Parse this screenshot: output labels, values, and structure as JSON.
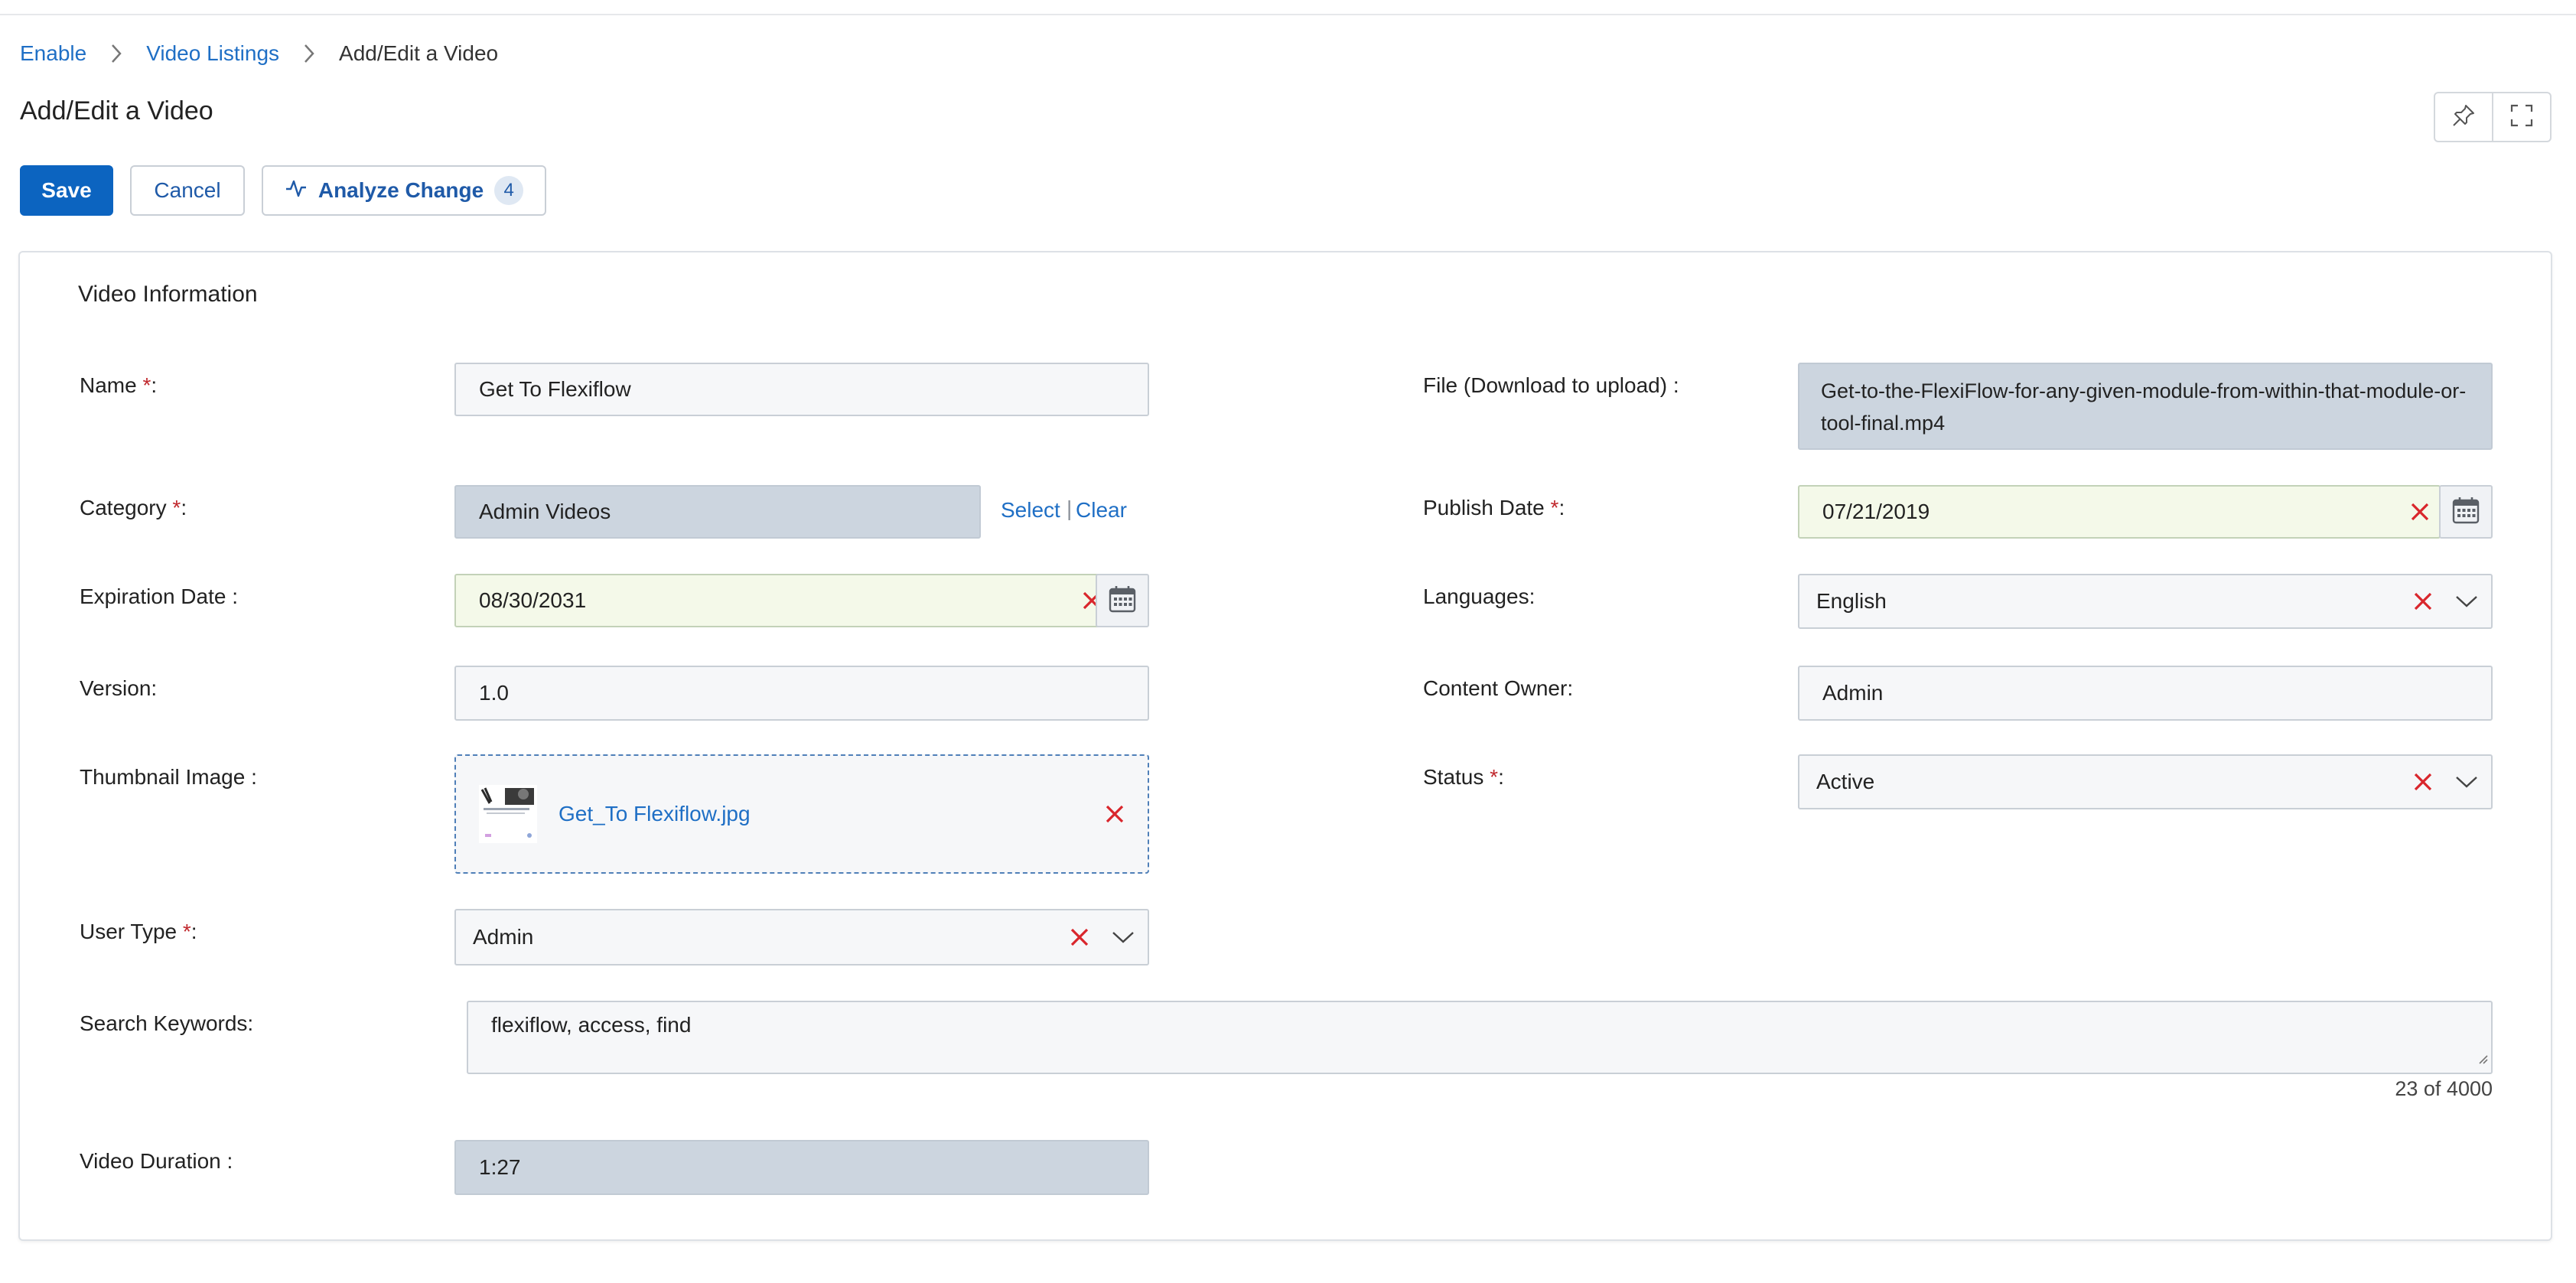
{
  "breadcrumb": {
    "items": [
      "Enable",
      "Video Listings"
    ],
    "current": "Add/Edit a Video"
  },
  "page": {
    "title": "Add/Edit a Video"
  },
  "toolbar": {
    "save_label": "Save",
    "cancel_label": "Cancel",
    "analyze_label": "Analyze Change",
    "analyze_count": "4"
  },
  "panel": {
    "title": "Video Information",
    "fields": {
      "name": {
        "label": "Name ",
        "required": "*",
        "suffix": ":",
        "value": "Get To Flexiflow"
      },
      "file": {
        "label": "File (Download to upload) :",
        "value": "Get-to-the-FlexiFlow-for-any-given-module-from-within-that-module-or-tool-final.mp4"
      },
      "category": {
        "label": "Category ",
        "required": "*",
        "suffix": ":",
        "value": "Admin Videos",
        "select_label": "Select",
        "separator": "|",
        "clear_label": "Clear"
      },
      "publish_date": {
        "label": "Publish Date ",
        "required": "*",
        "suffix": ":",
        "value": "07/21/2019"
      },
      "expiration_date": {
        "label": "Expiration Date :",
        "value": "08/30/2031"
      },
      "languages": {
        "label": "Languages:",
        "value": "English"
      },
      "version": {
        "label": "Version:",
        "value": "1.0"
      },
      "content_owner": {
        "label": "Content Owner:",
        "value": "Admin"
      },
      "thumbnail": {
        "label": "Thumbnail Image :",
        "file_name": "Get_To Flexiflow.jpg"
      },
      "status": {
        "label": "Status ",
        "required": "*",
        "suffix": ":",
        "value": "Active"
      },
      "user_type": {
        "label": "User Type ",
        "required": "*",
        "suffix": ":",
        "value": "Admin"
      },
      "search_keywords": {
        "label": "Search Keywords:",
        "value": "flexiflow, access, find",
        "counter": "23 of 4000"
      },
      "video_duration": {
        "label": "Video Duration :",
        "value": "1:27"
      }
    }
  },
  "colors": {
    "primary": "#0c64c0",
    "link": "#1f6fc5",
    "required": "#c0282d",
    "clear_icon": "#d9262c",
    "date_bg": "#f4f9e9",
    "readonly_bg": "#ccd5df"
  },
  "icons": {
    "breadcrumb_separator": "chevron-right-icon",
    "pin": "pin-icon",
    "fullscreen": "expand-icon",
    "analyze": "activity-icon",
    "clear": "close-icon",
    "calendar": "calendar-icon",
    "dropdown": "chevron-down-icon"
  }
}
